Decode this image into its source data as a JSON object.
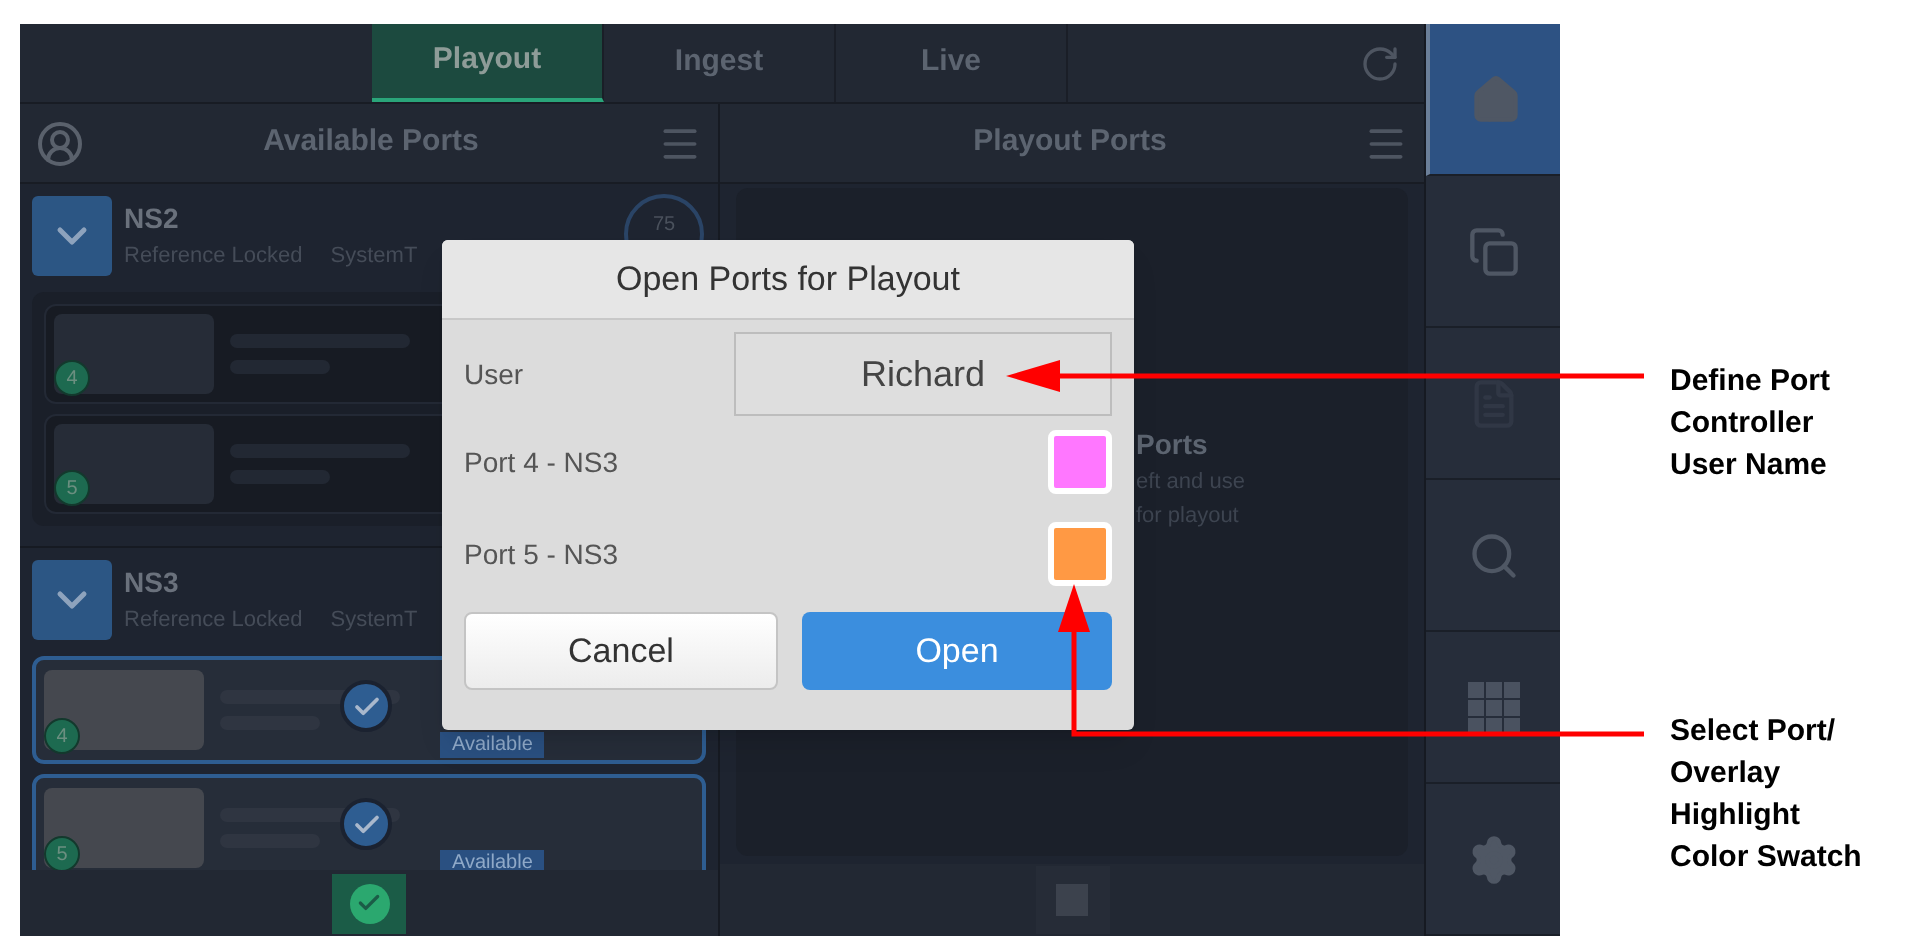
{
  "tabs": [
    {
      "label": "Playout",
      "selected": true
    },
    {
      "label": "Ingest",
      "selected": false
    },
    {
      "label": "Live",
      "selected": false
    }
  ],
  "available_ports": {
    "title": "Available Ports",
    "devices": [
      {
        "name": "NS2",
        "status": "Reference Locked",
        "system": "SystemT",
        "badge": "75",
        "ports": [
          {
            "number": "4",
            "selected": false
          },
          {
            "number": "5",
            "selected": false
          }
        ]
      },
      {
        "name": "NS3",
        "status": "Reference Locked",
        "system": "SystemT",
        "ports": [
          {
            "number": "4",
            "selected": true,
            "tag": "Available"
          },
          {
            "number": "5",
            "selected": true,
            "tag": "Available"
          }
        ]
      }
    ]
  },
  "playout_ports": {
    "title": "Playout Ports",
    "empty_title": "Ports",
    "empty_lines": [
      "eft and use",
      "for playout"
    ]
  },
  "dialog": {
    "title": "Open Ports for Playout",
    "user_label": "User",
    "user_value": "Richard",
    "ports": [
      {
        "label": "Port 4 - NS3",
        "color": "#ff77ff"
      },
      {
        "label": "Port 5 - NS3",
        "color": "#ff9944"
      }
    ],
    "buttons": [
      {
        "label": "Cancel",
        "kind": "secondary"
      },
      {
        "label": "Open",
        "kind": "primary"
      }
    ]
  },
  "sidebar": [
    {
      "kind": "home",
      "selected": true
    },
    {
      "kind": "windows",
      "selected": false
    },
    {
      "kind": "document",
      "selected": false
    },
    {
      "kind": "search",
      "selected": false
    },
    {
      "kind": "grid",
      "selected": false
    },
    {
      "kind": "settings",
      "selected": false
    }
  ],
  "callouts": [
    {
      "lines": [
        "Define Port",
        "Controller",
        "User Name"
      ]
    },
    {
      "lines": [
        "Select Port/",
        "Overlay",
        "Highlight",
        "Color Swatch"
      ]
    }
  ]
}
